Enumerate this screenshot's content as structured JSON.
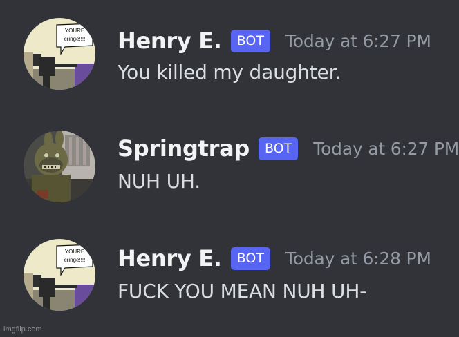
{
  "messages": [
    {
      "username": "Henry E.",
      "tag": "BOT",
      "timestamp": "Today at 6:27 PM",
      "content": "You killed my daughter.",
      "avatar_text": [
        "YOURE",
        "cringe!!!!"
      ]
    },
    {
      "username": "Springtrap",
      "tag": "BOT",
      "timestamp": "Today at 6:27 PM",
      "content": "NUH UH."
    },
    {
      "username": "Henry E.",
      "tag": "BOT",
      "timestamp": "Today at 6:28 PM",
      "content": "FUCK YOU MEAN NUH UH-",
      "avatar_text": [
        "YOURE",
        "cringe!!!!"
      ]
    }
  ],
  "watermark": "imgflip.com",
  "colors": {
    "background": "#313338",
    "username": "#f2f3f5",
    "bot_tag": "#5865f2",
    "timestamp": "#949ba4",
    "content": "#dbdee1"
  }
}
